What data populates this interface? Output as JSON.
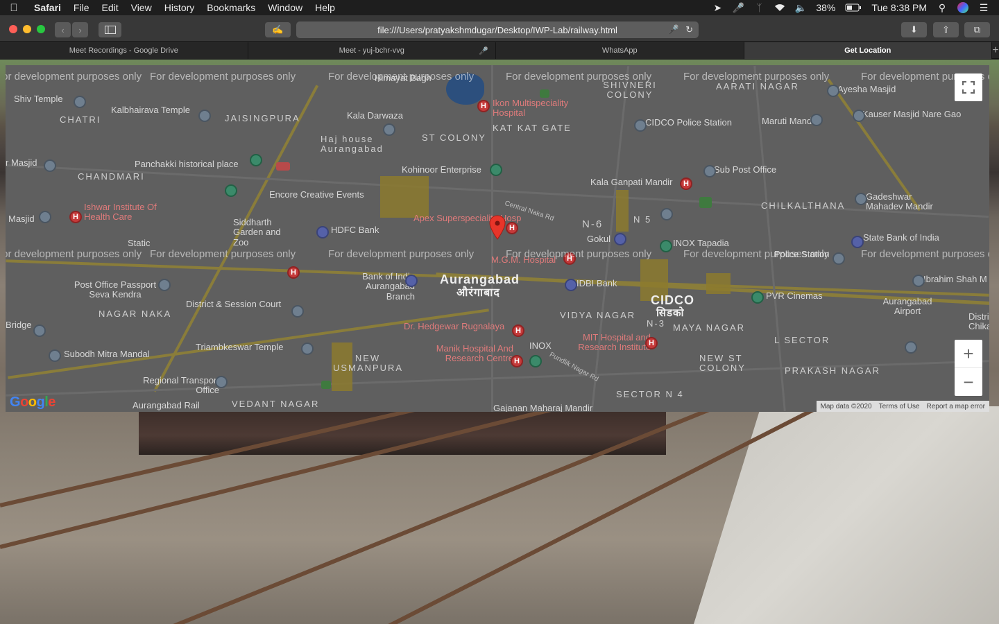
{
  "menubar": {
    "app": "Safari",
    "items": [
      "File",
      "Edit",
      "View",
      "History",
      "Bookmarks",
      "Window",
      "Help"
    ],
    "battery": "38%",
    "clock": "Tue 8:38 PM"
  },
  "toolbar": {
    "url": "file:///Users/pratyakshmdugar/Desktop/IWP-Lab/railway.html"
  },
  "tabs": [
    {
      "label": "Meet Recordings - Google Drive"
    },
    {
      "label": "Meet - yuj-bchr-vvg"
    },
    {
      "label": "WhatsApp"
    },
    {
      "label": "Get Location"
    }
  ],
  "map": {
    "watermark": "For development purposes only",
    "labels": {
      "aurangabad": "Aurangabad",
      "aurangabad_dev": "औरंगाबाद",
      "cidco": "CIDCO",
      "cidco_dev": "सिडको",
      "n6": "N-6",
      "n5": "N 5",
      "n3": "N-3",
      "chikalthana": "CHILKALTHANA",
      "chandmari": "CHANDMARI",
      "jaisingpura": "JAISINGPURA",
      "shivneri": "SHIVNERI COLONY",
      "aarati": "AARATI NAGAR",
      "st_colony": "ST COLONY",
      "katkat": "KAT KAT GATE",
      "vidya": "VIDYA NAGAR",
      "maya": "MAYA NAGAR",
      "l_sector": "L SECTOR",
      "new_st": "NEW ST COLONY",
      "prakash": "PRAKASH NAGAR",
      "sector_n4": "SECTOR N 4",
      "new_usman": "NEW USMANPURA",
      "vedant": "VEDANT NAGAR",
      "nagar_naka": "NAGAR NAKA",
      "chatri": "CHATRI",
      "himayat": "Himayat Bagh",
      "kala_darwaza": "Kala Darwaza",
      "haj_house": "Haj house Aurangabad",
      "panchakki": "Panchakki historical place",
      "kohinoor": "Kohinoor Enterprise",
      "encore": "Encore Creative Events",
      "ishwar": "Ishwar Institute Of Health Care",
      "siddharth": "Siddharth Garden and Zoo",
      "hdfc": "HDFC Bank",
      "apex": "Apex Superspeciality Hosp",
      "mgm": "M.G.M. Hospital",
      "gokul": "Gokul",
      "inox_tapadia": "INOX Tapadia",
      "sbi": "State Bank of India",
      "police": "Police Station",
      "pvr": "PVR Cinemas",
      "idbi": "IDBI Bank",
      "boi": "Bank of India Aurangabad Branch",
      "post_office": "Post Office Passport Seva Kendra",
      "district_court": "District & Session Court",
      "hedgewar": "Dr. Hedgewar Rugnalaya",
      "inox": "INOX",
      "mit": "MIT Hospital and Research Institute",
      "manik": "Manik Hospital And Research Centre",
      "triambkeswar": "Triambkeswar Temple",
      "subodh": "Subodh Mitra Mandal",
      "regional": "Regional Transport Office",
      "rail": "Aurangabad Rail",
      "airport": "Aurangabad Airport",
      "ikon": "Ikon Multispeciality Hospital",
      "cidco_police": "CIDCO Police Station",
      "maruti": "Maruti Mandir",
      "ayesha": "Ayesha Masjid",
      "kauser": "Kauser Masjid Nare Gao",
      "sub_post": "Sub Post Office",
      "kala_ganpati": "Kala Ganpati Mandir",
      "gadeshwar": "Gadeshwar Mahadev Mandir",
      "ibrahim": "Ibrahim Shah M",
      "shiv_temple": "Shiv Temple",
      "kalbhairava": "Kalbhairava Temple",
      "masjid": "Masjid",
      "r_masjid": "r Masjid",
      "central_naka": "Central Naka Rd",
      "pundlik": "Pundlik Nagar Rd",
      "gajanan": "Gajanan Maharaj Mandir",
      "bridge": "Bridge",
      "station": "Static",
      "district": "District Chikalt"
    },
    "attribution": {
      "map_data": "Map data ©2020",
      "terms": "Terms of Use",
      "report": "Report a map error"
    },
    "google": "Google"
  }
}
